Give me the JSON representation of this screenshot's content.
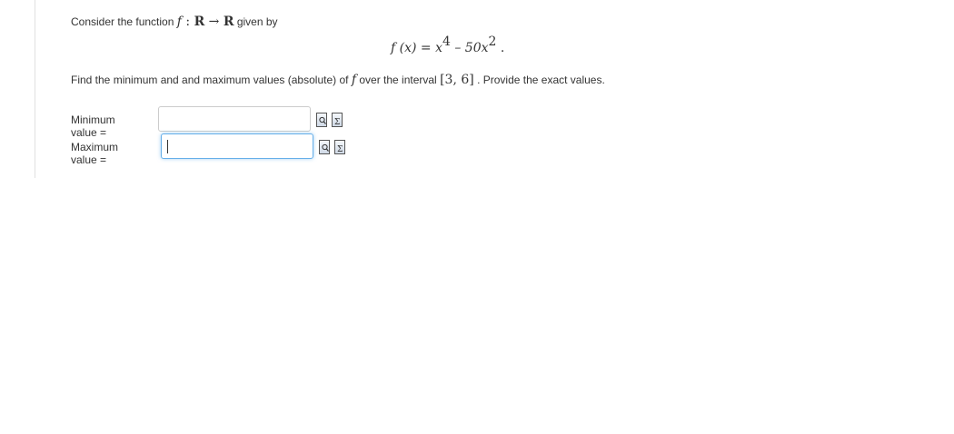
{
  "question": {
    "intro_prefix": "Consider the function",
    "intro_f": "f",
    "intro_colon": " : ",
    "intro_domain": "R",
    "intro_arrow": " → ",
    "intro_codomain": "R",
    "intro_suffix": "given by",
    "formula_lhs": "f (x) = x",
    "formula_exp1": "4",
    "formula_mid": " – 50x",
    "formula_exp2": "2",
    "formula_end": " .",
    "find_prefix": "Find the minimum and and maximum values (absolute) of",
    "find_f": "f",
    "find_middle": "over the interval",
    "find_interval": "[3, 6]",
    "find_suffix": ". Provide the exact values."
  },
  "answers": {
    "min_label": "Minimum value =",
    "min_value": "",
    "max_label": "Maximum value =",
    "max_value": ""
  },
  "icons": {
    "preview": "preview-answer-icon",
    "equation_editor": "equation-editor-icon"
  },
  "colors": {
    "focus_border": "#66afe9",
    "text": "#333333"
  }
}
